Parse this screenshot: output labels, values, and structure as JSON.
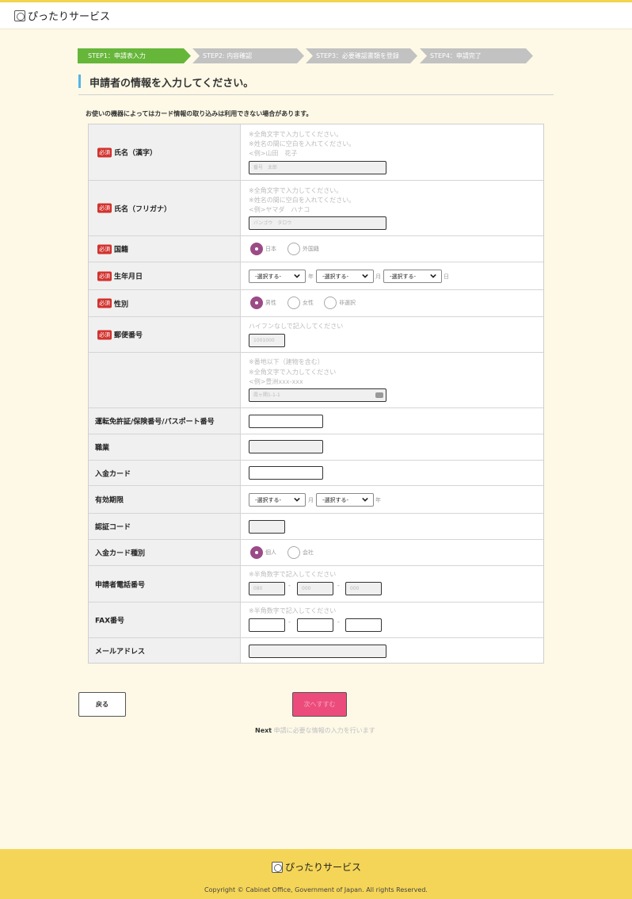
{
  "header": {
    "logo_text": "ぴったりサービス"
  },
  "steps": [
    {
      "label": "STEP1：申請表入力",
      "active": true
    },
    {
      "label": "STEP2: 内容確認",
      "active": false
    },
    {
      "label": "STEP3：必要確認書類を登録",
      "active": false
    },
    {
      "label": "STEP4：申請完了",
      "active": false
    }
  ],
  "page_title": "申請者の情報を入力してください。",
  "notice": "お使いの機器によってはカード情報の取り込みは利用できない場合があります。",
  "required_badge": "必須",
  "form": {
    "name_kanji": {
      "label": "氏名（漢字）",
      "hint1": "※全角文字で入力してください。",
      "hint2": "※姓名の間に空白を入れてください。",
      "hint3": "<例>山田　花子",
      "placeholder": "番号　太郎"
    },
    "name_kana": {
      "label": "氏名（フリガナ）",
      "hint1": "※全角文字で入力してください。",
      "hint2": "※姓名の間に空白を入れてください。",
      "hint3": "<例>ヤマダ　ハナコ",
      "placeholder": "バンゴウ　タロウ"
    },
    "nationality": {
      "label": "国籍",
      "options": [
        "日本",
        "外国籍"
      ],
      "selected": "日本"
    },
    "birthdate": {
      "label": "生年月日",
      "select_text": "-選択する-",
      "units": [
        "年",
        "月",
        "日"
      ]
    },
    "gender": {
      "label": "性別",
      "options": [
        "男性",
        "女性",
        "非選択"
      ],
      "selected": "男性"
    },
    "postal": {
      "label": "郵便番号",
      "hint": "ハイフンなしで記入してください",
      "placeholder": "1001000"
    },
    "address": {
      "hint1": "※番地以下（建物を含む）",
      "hint2": "※全角文字で入力してください",
      "hint3": "<例>豊洲xxx-xxx",
      "placeholder": "霞ヶ関1-1-1"
    },
    "license": {
      "label": "運転免許証/保険番号/パスポート番号"
    },
    "occupation": {
      "label": "職業"
    },
    "card": {
      "label": "入金カード"
    },
    "expiry": {
      "label": "有効期限",
      "select_text": "-選択する-",
      "units": [
        "月",
        "年"
      ]
    },
    "auth_code": {
      "label": "認証コード"
    },
    "card_type": {
      "label": "入金カード種別",
      "options": [
        "個人",
        "会社"
      ],
      "selected": "個人"
    },
    "phone": {
      "label": "申請者電話番号",
      "hint": "※半角数字で記入してください",
      "placeholders": [
        "080",
        "000",
        "000"
      ],
      "dash": "-"
    },
    "fax": {
      "label": "FAX番号",
      "hint": "※半角数字で記入してください",
      "dash": "-"
    },
    "email": {
      "label": "メールアドレス"
    }
  },
  "buttons": {
    "back": "戻る",
    "next": "次へすすむ",
    "next_note_key": "Next",
    "next_note_desc": "申請に必要な情報の入力を行います"
  },
  "footer": {
    "logo_text": "ぴったりサービス",
    "copyright": "Copyright © Cabinet Office, Government of Japan. All rights Reserved."
  },
  "colors": {
    "accent_yellow": "#f5d557",
    "step_active": "#66b63a",
    "step_inactive": "#c2c2c2",
    "required_red": "#d2322d",
    "radio_selected": "#9b4b86",
    "next_button": "#ec4c7c"
  },
  "icons": [
    "logo-icon",
    "chevron-down-icon",
    "clear-icon"
  ]
}
